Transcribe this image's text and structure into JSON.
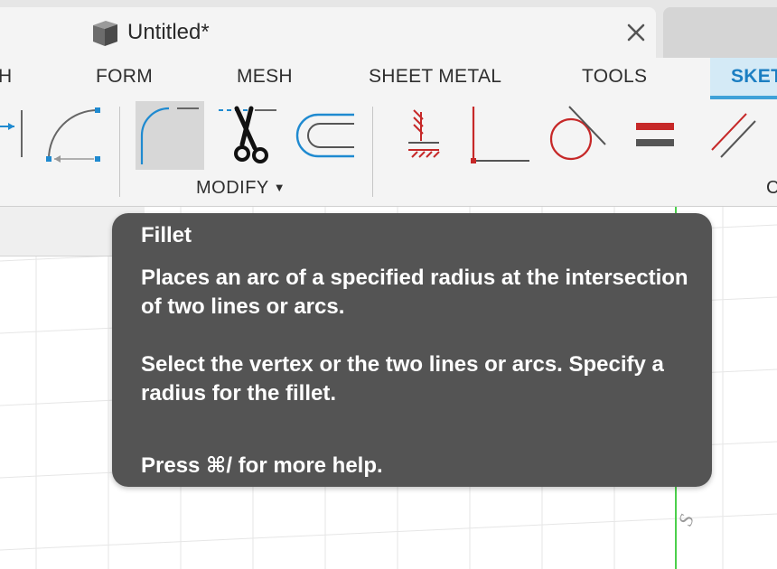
{
  "window": {
    "document_title": "Untitled*",
    "doc_icon": "box-3d-icon",
    "close_icon": "close-icon"
  },
  "ribbon": {
    "tabs": [
      {
        "label": "H",
        "active": false
      },
      {
        "label": "FORM",
        "active": false
      },
      {
        "label": "MESH",
        "active": false
      },
      {
        "label": "SHEET METAL",
        "active": false
      },
      {
        "label": "TOOLS",
        "active": false
      },
      {
        "label": "SKET",
        "active": true
      }
    ],
    "tools": [
      {
        "icon": "dimension-line-icon"
      },
      {
        "icon": "arc-icon"
      },
      {
        "icon": "fillet-icon",
        "selected": true
      },
      {
        "icon": "trim-scissors-icon"
      },
      {
        "icon": "offset-icon"
      },
      {
        "icon": "fix-constraint-icon"
      },
      {
        "icon": "perpendicular-constraint-icon"
      },
      {
        "icon": "tangent-constraint-icon"
      },
      {
        "icon": "equal-constraint-icon"
      },
      {
        "icon": "parallel-constraint-icon"
      }
    ],
    "group_label": "MODIFY",
    "group_label_right": "C",
    "accent_color": "#1b7ec2",
    "constraint_color": "#c62828"
  },
  "tooltip": {
    "title": "Fillet",
    "paragraph1": "Places an arc of a specified radius at the intersection of two lines or arcs.",
    "paragraph2": "Select the vertex or the two lines or arcs. Specify a radius for the fillet.",
    "help": "Press ⌘/ for more help.",
    "background": "#545454"
  },
  "canvas": {
    "grid_label": "S"
  }
}
